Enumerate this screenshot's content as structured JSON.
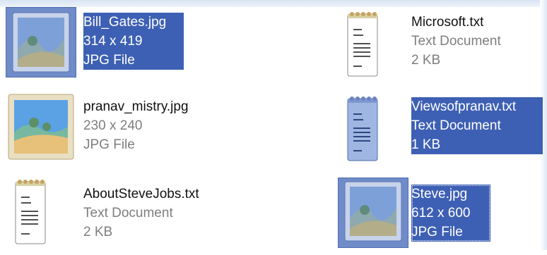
{
  "files": [
    {
      "name": "Bill_Gates.jpg",
      "detail": "314 x 419",
      "type": "JPG File",
      "icon": "jpg-image-icon",
      "selected": true
    },
    {
      "name": "Microsoft.txt",
      "detail": "Text Document",
      "type": "2 KB",
      "icon": "text-document-icon",
      "selected": false
    },
    {
      "name": "pranav_mistry.jpg",
      "detail": "230 x 240",
      "type": "JPG File",
      "icon": "jpg-image-icon",
      "selected": false
    },
    {
      "name": "Viewsofpranav.txt",
      "detail": "Text Document",
      "type": "1 KB",
      "icon": "text-document-icon",
      "selected": true
    },
    {
      "name": "AboutSteveJobs.txt",
      "detail": "Text Document",
      "type": "2 KB",
      "icon": "text-document-icon",
      "selected": false
    },
    {
      "name": "Steve.jpg",
      "detail": "612 x 600",
      "type": "JPG File",
      "icon": "jpg-image-icon",
      "selected": true
    }
  ],
  "colors": {
    "selection": "#3e60b4",
    "secondary_text": "#7e7e7e"
  }
}
